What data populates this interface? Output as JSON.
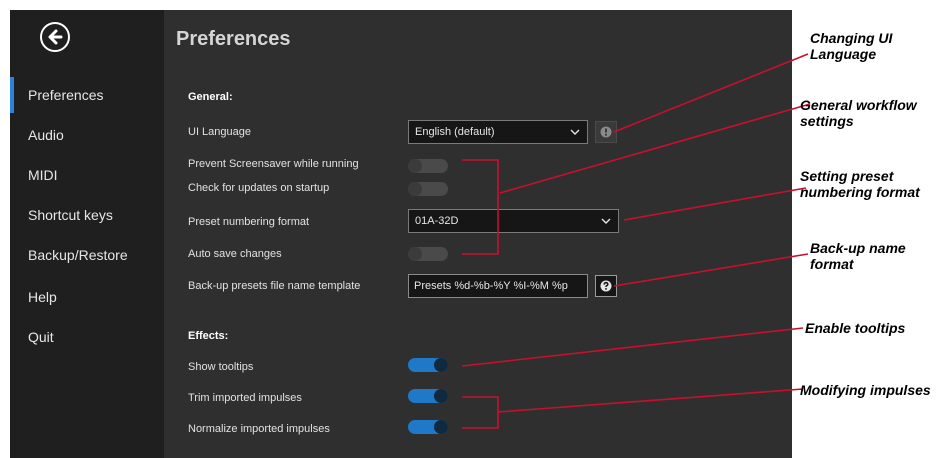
{
  "sidebar": {
    "items": [
      {
        "label": "Preferences",
        "active": true
      },
      {
        "label": "Audio"
      },
      {
        "label": "MIDI"
      },
      {
        "label": "Shortcut keys"
      },
      {
        "label": "Backup/Restore"
      },
      {
        "label": "Help"
      },
      {
        "label": "Quit"
      }
    ]
  },
  "header": {
    "title": "Preferences"
  },
  "general": {
    "title": "General:",
    "ui_language": {
      "label": "UI Language",
      "value": "English (default)"
    },
    "prevent_screensaver": {
      "label": "Prevent Screensaver while running",
      "on": false
    },
    "check_updates": {
      "label": "Check for updates on startup",
      "on": false
    },
    "preset_numbering": {
      "label": "Preset numbering format",
      "value": "01A-32D"
    },
    "auto_save": {
      "label": "Auto save changes",
      "on": false
    },
    "backup_template": {
      "label": "Back-up presets file name template",
      "value": "Presets %d-%b-%Y %I-%M %p"
    }
  },
  "effects": {
    "title": "Effects:",
    "show_tooltips": {
      "label": "Show tooltips",
      "on": true
    },
    "trim_impulses": {
      "label": "Trim imported impulses",
      "on": true
    },
    "normalize_impulses": {
      "label": "Normalize imported impulses",
      "on": true
    }
  },
  "annotations": {
    "ui_language": {
      "line1": "Changing UI",
      "line2": "Language"
    },
    "workflow": {
      "line1": "General workflow",
      "line2": "settings"
    },
    "numbering": {
      "line1": "Setting preset",
      "line2": "numbering format"
    },
    "backup": {
      "line1": "Back-up name",
      "line2": "format"
    },
    "tooltips": {
      "line1": "Enable tooltips"
    },
    "impulses": {
      "line1": "Modifying impulses"
    }
  },
  "icons": {
    "back": "arrow-left-circle-icon",
    "chevron": "chevron-down-icon",
    "info": "info-icon",
    "help": "question-icon"
  },
  "colors": {
    "sidebar_bg": "#1f1f1f",
    "panel_bg": "#2f2f2f",
    "accent": "#2a82da",
    "toggle_on": "#1f78c8",
    "callout_line": "#c8102e"
  }
}
